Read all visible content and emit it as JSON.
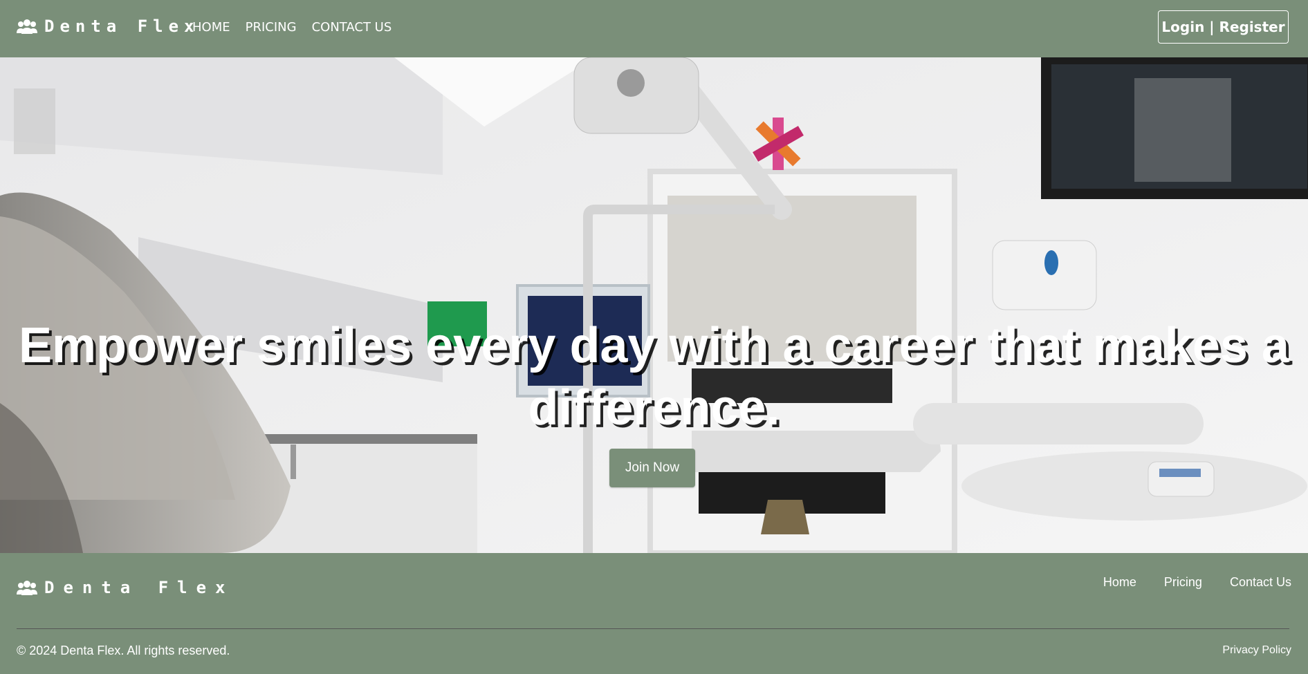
{
  "navbar": {
    "brand": "Denta Flex",
    "links": [
      "HOME",
      "PRICING",
      "CONTACT US"
    ],
    "login_label": "Login | Register"
  },
  "hero": {
    "title": "Empower smiles every day with a career that makes a difference.",
    "cta_label": "Join Now"
  },
  "footer": {
    "brand": "Denta Flex",
    "links": [
      "Home",
      "Pricing",
      "Contact Us"
    ],
    "copyright": "© 2024 Denta Flex. All rights reserved.",
    "privacy": "Privacy Policy"
  },
  "colors": {
    "brand_green": "#7a8f79",
    "text_white": "#ffffff"
  },
  "icons": {
    "brand": "users-icon"
  }
}
